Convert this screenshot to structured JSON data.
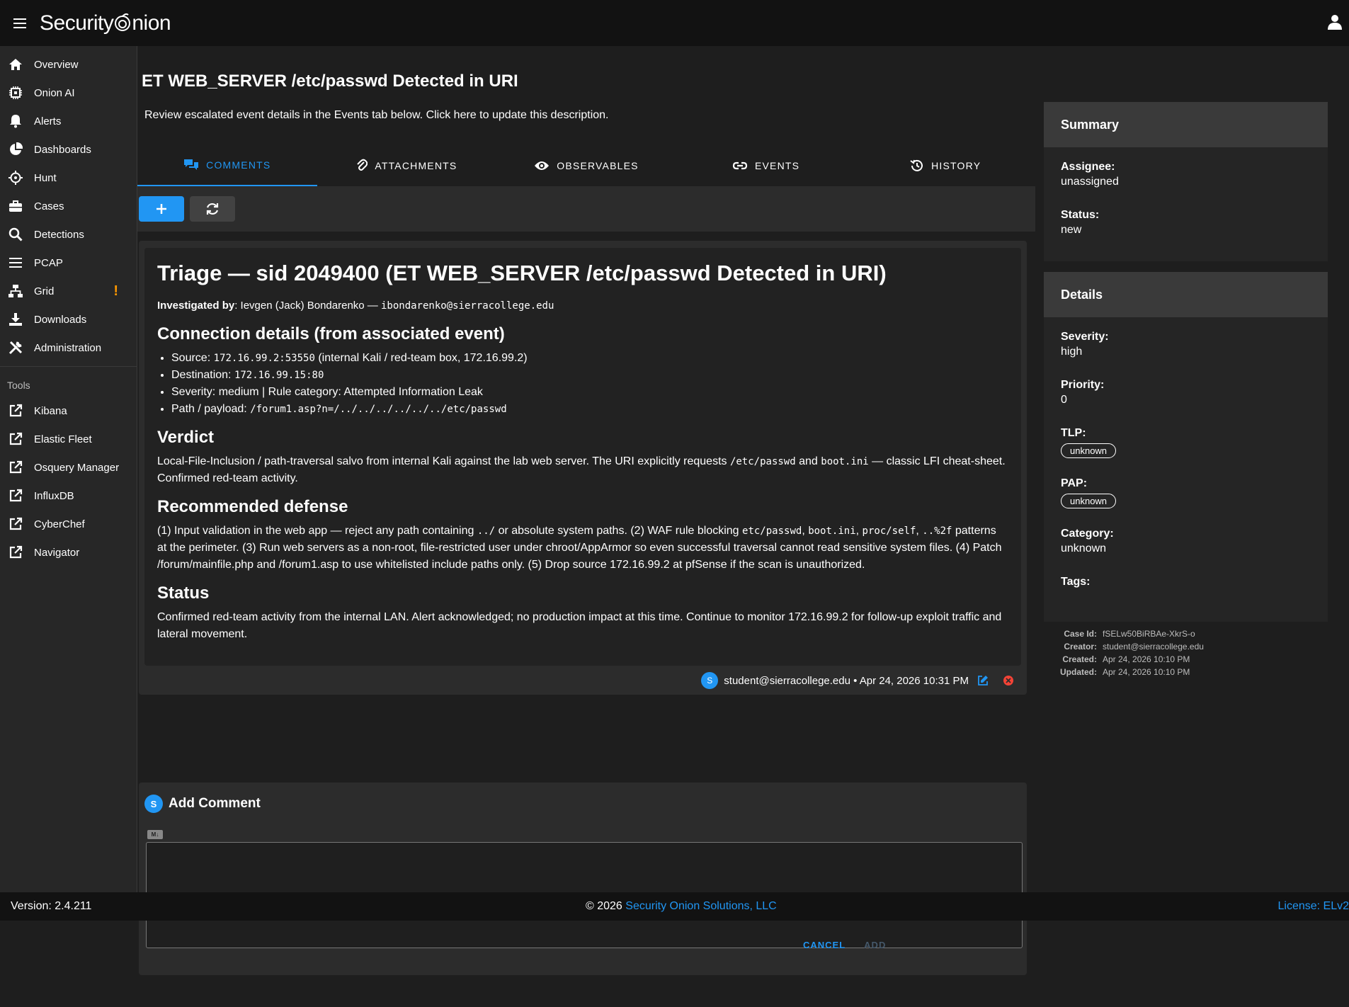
{
  "app": {
    "logo_text_1": "Security",
    "logo_text_2": "nion"
  },
  "sidebar": {
    "items": [
      {
        "label": "Overview",
        "icon": "home-icon"
      },
      {
        "label": "Onion AI",
        "icon": "chip-icon"
      },
      {
        "label": "Alerts",
        "icon": "bell-icon"
      },
      {
        "label": "Dashboards",
        "icon": "pie-chart-icon"
      },
      {
        "label": "Hunt",
        "icon": "crosshairs-icon"
      },
      {
        "label": "Cases",
        "icon": "briefcase-icon"
      },
      {
        "label": "Detections",
        "icon": "search-icon"
      },
      {
        "label": "PCAP",
        "icon": "list-icon"
      },
      {
        "label": "Grid",
        "icon": "network-icon",
        "badge": "!"
      },
      {
        "label": "Downloads",
        "icon": "download-icon"
      },
      {
        "label": "Administration",
        "icon": "tools-icon"
      }
    ],
    "tools_header": "Tools",
    "tools": [
      {
        "label": "Kibana",
        "icon": "external-link-icon"
      },
      {
        "label": "Elastic Fleet",
        "icon": "external-link-icon"
      },
      {
        "label": "Osquery Manager",
        "icon": "external-link-icon"
      },
      {
        "label": "InfluxDB",
        "icon": "external-link-icon"
      },
      {
        "label": "CyberChef",
        "icon": "external-link-icon"
      },
      {
        "label": "Navigator",
        "icon": "external-link-icon"
      }
    ]
  },
  "case": {
    "title": "ET WEB_SERVER /etc/passwd Detected in URI",
    "description": "Review escalated event details in the Events tab below. Click here to update this description."
  },
  "tabs": [
    {
      "label": "COMMENTS",
      "icon": "comments-icon",
      "active": true
    },
    {
      "label": "ATTACHMENTS",
      "icon": "paperclip-icon",
      "active": false
    },
    {
      "label": "OBSERVABLES",
      "icon": "eye-icon",
      "active": false
    },
    {
      "label": "EVENTS",
      "icon": "link-icon",
      "active": false
    },
    {
      "label": "HISTORY",
      "icon": "history-icon",
      "active": false
    }
  ],
  "comment": {
    "h1": "Triage — sid 2049400 (ET WEB_SERVER /etc/passwd Detected in URI)",
    "investigated_label": "Investigated by",
    "investigated_name": ": Ievgen (Jack) Bondarenko — ",
    "investigated_email": "ibondarenko@sierracollege.edu",
    "h2_connection": "Connection details (from associated event)",
    "conn": {
      "source_label": "Source: ",
      "source_val": "172.16.99.2:53550",
      "source_note": " (internal Kali / red-team box, 172.16.99.2)",
      "dest_label": "Destination: ",
      "dest_val": "172.16.99.15:80",
      "severity_line": "Severity: medium | Rule category: Attempted Information Leak",
      "path_label": "Path / payload: ",
      "path_val": "/forum1.asp?n=/../../../../../../etc/passwd"
    },
    "h2_verdict": "Verdict",
    "verdict": {
      "t1": "Local-File-Inclusion / path-traversal salvo from internal Kali against the lab web server. The URI explicitly requests ",
      "c1": "/etc/passwd",
      "t2": " and ",
      "c2": "boot.ini",
      "t3": " — classic LFI cheat-sheet. Confirmed red-team activity."
    },
    "h2_defense": "Recommended defense",
    "defense": {
      "t1": "(1) Input validation in the web app — reject any path containing ",
      "c1": "../",
      "t2": " or absolute system paths. (2) WAF rule blocking ",
      "c2": "etc/passwd",
      "t3": ", ",
      "c3": "boot.ini",
      "t4": ", ",
      "c4": "proc/self",
      "t5": ", ",
      "c5": "..%2f",
      "t6": " patterns at the perimeter. (3) Run web servers as a non-root, file-restricted user under chroot/AppArmor so even successful traversal cannot read sensitive system files. (4) Patch /forum/mainfile.php and /forum1.asp to use whitelisted include paths only. (5) Drop source 172.16.99.2 at pfSense if the scan is unauthorized."
    },
    "h2_status": "Status",
    "status_text": "Confirmed red-team activity from the internal LAN. Alert acknowledged; no production impact at this time. Continue to monitor 172.16.99.2 for follow-up exploit traffic and lateral movement.",
    "footer": {
      "avatar": "S",
      "meta": "student@sierracollege.edu • Apr 24, 2026 10:31 PM"
    }
  },
  "add_comment": {
    "avatar": "S",
    "title": "Add Comment",
    "md_badge": "M↓",
    "cancel": "CANCEL",
    "add": "ADD"
  },
  "summary": {
    "title": "Summary",
    "assignee_label": "Assignee:",
    "assignee": "unassigned",
    "status_label": "Status:",
    "status": "new"
  },
  "details": {
    "title": "Details",
    "severity_label": "Severity:",
    "severity": "high",
    "priority_label": "Priority:",
    "priority": "0",
    "tlp_label": "TLP:",
    "tlp": "unknown",
    "pap_label": "PAP:",
    "pap": "unknown",
    "category_label": "Category:",
    "category": "unknown",
    "tags_label": "Tags:"
  },
  "meta": {
    "case_id_label": "Case Id:",
    "case_id": "fSELw50BiRBAe-XkrS-o",
    "creator_label": "Creator:",
    "creator": "student@sierracollege.edu",
    "created_label": "Created:",
    "created": "Apr 24, 2026 10:10 PM",
    "updated_label": "Updated:",
    "updated": "Apr 24, 2026 10:10 PM"
  },
  "footer": {
    "version": "Version: 2.4.211",
    "copyright": "© 2026 ",
    "company": "Security Onion Solutions, LLC",
    "license": "License:  ELv2"
  },
  "colors": {
    "accent": "#2196f3",
    "warning": "#ff9800",
    "danger": "#f44336"
  }
}
